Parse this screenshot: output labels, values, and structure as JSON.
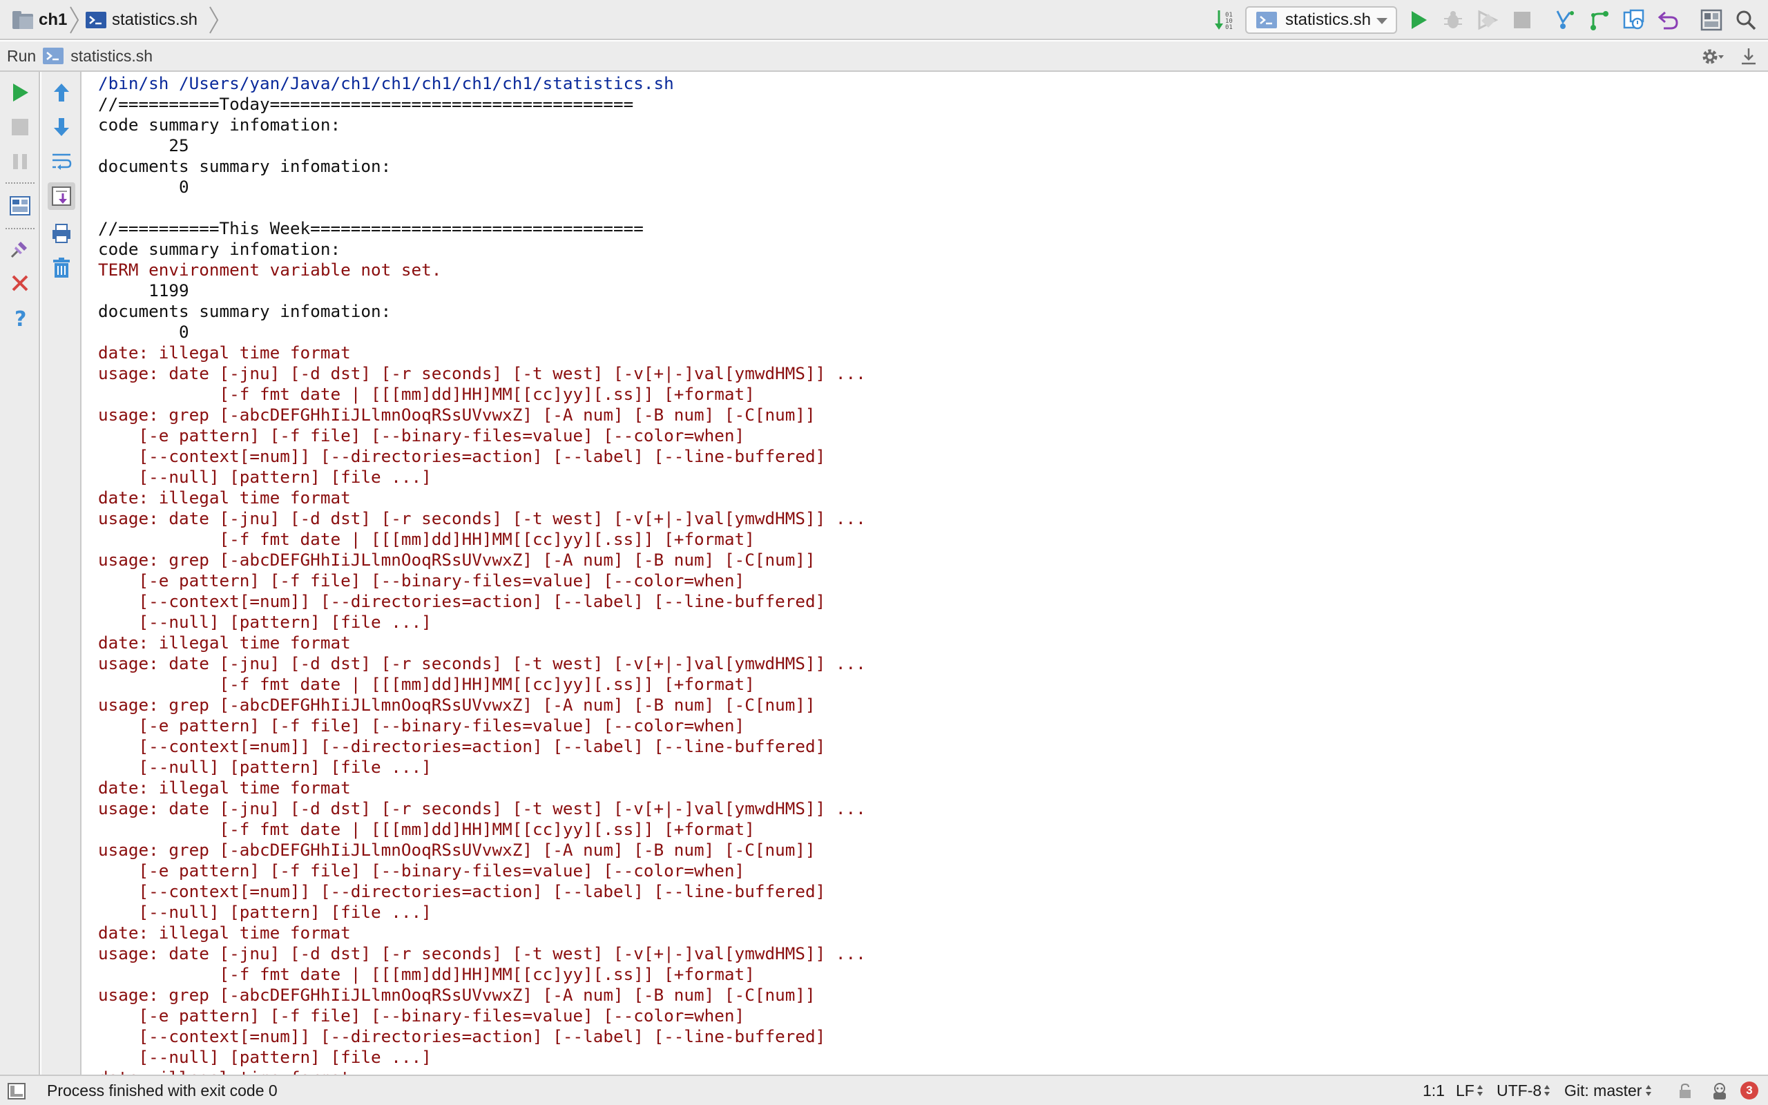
{
  "navbar": {
    "breadcrumbs": [
      {
        "label": "ch1",
        "icon": "folder-icon"
      },
      {
        "label": "statistics.sh",
        "icon": "shell-script-icon"
      }
    ],
    "run_config": {
      "label": "statistics.sh",
      "icon": "shell-script-icon"
    },
    "toolbar_icons": [
      "sort-icon",
      "run-icon",
      "debug-icon",
      "coverage-icon",
      "stop-icon",
      "vcs-update-icon",
      "vcs-commit-icon",
      "vcs-compare-icon",
      "vcs-revert-icon",
      "project-structure-icon",
      "search-icon"
    ]
  },
  "run_window": {
    "title": "Run",
    "tab_label": "statistics.sh",
    "header_icons": [
      "gear-icon",
      "hide-icon"
    ]
  },
  "left_toolbar": {
    "primary": [
      "rerun-icon",
      "stop-icon",
      "pause-icon",
      "restore-layout-icon",
      "pin-icon",
      "close-icon",
      "help-icon"
    ],
    "secondary": [
      "scroll-up-icon",
      "scroll-down-icon",
      "soft-wrap-icon",
      "scroll-to-end-icon",
      "print-icon",
      "clear-all-icon"
    ]
  },
  "console": {
    "lines": [
      {
        "text": "/bin/sh /Users/yan/Java/ch1/ch1/ch1/ch1/ch1/statistics.sh",
        "type": "sys"
      },
      {
        "text": "//==========Today====================================",
        "type": "out"
      },
      {
        "text": "code summary infomation:",
        "type": "out"
      },
      {
        "text": "       25",
        "type": "out"
      },
      {
        "text": "documents summary infomation:",
        "type": "out"
      },
      {
        "text": "        0",
        "type": "out"
      },
      {
        "text": "",
        "type": "out"
      },
      {
        "text": "//==========This Week=================================",
        "type": "out"
      },
      {
        "text": "code summary infomation:",
        "type": "out"
      },
      {
        "text": "TERM environment variable not set.",
        "type": "err"
      },
      {
        "text": "     1199",
        "type": "out"
      },
      {
        "text": "documents summary infomation:",
        "type": "out"
      },
      {
        "text": "        0",
        "type": "out"
      },
      {
        "text": "date: illegal time format",
        "type": "err"
      },
      {
        "text": "usage: date [-jnu] [-d dst] [-r seconds] [-t west] [-v[+|-]val[ymwdHMS]] ...",
        "type": "err"
      },
      {
        "text": "            [-f fmt date | [[[mm]dd]HH]MM[[cc]yy][.ss]] [+format]",
        "type": "err"
      },
      {
        "text": "usage: grep [-abcDEFGHhIiJLlmnOoqRSsUVvwxZ] [-A num] [-B num] [-C[num]]",
        "type": "err"
      },
      {
        "text": "    [-e pattern] [-f file] [--binary-files=value] [--color=when]",
        "type": "err"
      },
      {
        "text": "    [--context[=num]] [--directories=action] [--label] [--line-buffered]",
        "type": "err"
      },
      {
        "text": "    [--null] [pattern] [file ...]",
        "type": "err"
      },
      {
        "text": "date: illegal time format",
        "type": "err"
      },
      {
        "text": "usage: date [-jnu] [-d dst] [-r seconds] [-t west] [-v[+|-]val[ymwdHMS]] ...",
        "type": "err"
      },
      {
        "text": "            [-f fmt date | [[[mm]dd]HH]MM[[cc]yy][.ss]] [+format]",
        "type": "err"
      },
      {
        "text": "usage: grep [-abcDEFGHhIiJLlmnOoqRSsUVvwxZ] [-A num] [-B num] [-C[num]]",
        "type": "err"
      },
      {
        "text": "    [-e pattern] [-f file] [--binary-files=value] [--color=when]",
        "type": "err"
      },
      {
        "text": "    [--context[=num]] [--directories=action] [--label] [--line-buffered]",
        "type": "err"
      },
      {
        "text": "    [--null] [pattern] [file ...]",
        "type": "err"
      },
      {
        "text": "date: illegal time format",
        "type": "err"
      },
      {
        "text": "usage: date [-jnu] [-d dst] [-r seconds] [-t west] [-v[+|-]val[ymwdHMS]] ...",
        "type": "err"
      },
      {
        "text": "            [-f fmt date | [[[mm]dd]HH]MM[[cc]yy][.ss]] [+format]",
        "type": "err"
      },
      {
        "text": "usage: grep [-abcDEFGHhIiJLlmnOoqRSsUVvwxZ] [-A num] [-B num] [-C[num]]",
        "type": "err"
      },
      {
        "text": "    [-e pattern] [-f file] [--binary-files=value] [--color=when]",
        "type": "err"
      },
      {
        "text": "    [--context[=num]] [--directories=action] [--label] [--line-buffered]",
        "type": "err"
      },
      {
        "text": "    [--null] [pattern] [file ...]",
        "type": "err"
      },
      {
        "text": "date: illegal time format",
        "type": "err"
      },
      {
        "text": "usage: date [-jnu] [-d dst] [-r seconds] [-t west] [-v[+|-]val[ymwdHMS]] ...",
        "type": "err"
      },
      {
        "text": "            [-f fmt date | [[[mm]dd]HH]MM[[cc]yy][.ss]] [+format]",
        "type": "err"
      },
      {
        "text": "usage: grep [-abcDEFGHhIiJLlmnOoqRSsUVvwxZ] [-A num] [-B num] [-C[num]]",
        "type": "err"
      },
      {
        "text": "    [-e pattern] [-f file] [--binary-files=value] [--color=when]",
        "type": "err"
      },
      {
        "text": "    [--context[=num]] [--directories=action] [--label] [--line-buffered]",
        "type": "err"
      },
      {
        "text": "    [--null] [pattern] [file ...]",
        "type": "err"
      },
      {
        "text": "date: illegal time format",
        "type": "err"
      },
      {
        "text": "usage: date [-jnu] [-d dst] [-r seconds] [-t west] [-v[+|-]val[ymwdHMS]] ...",
        "type": "err"
      },
      {
        "text": "            [-f fmt date | [[[mm]dd]HH]MM[[cc]yy][.ss]] [+format]",
        "type": "err"
      },
      {
        "text": "usage: grep [-abcDEFGHhIiJLlmnOoqRSsUVvwxZ] [-A num] [-B num] [-C[num]]",
        "type": "err"
      },
      {
        "text": "    [-e pattern] [-f file] [--binary-files=value] [--color=when]",
        "type": "err"
      },
      {
        "text": "    [--context[=num]] [--directories=action] [--label] [--line-buffered]",
        "type": "err"
      },
      {
        "text": "    [--null] [pattern] [file ...]",
        "type": "err"
      },
      {
        "text": "date: illegal time format",
        "type": "err"
      }
    ]
  },
  "statusbar": {
    "message": "Process finished with exit code 0",
    "position": "1:1",
    "line_separator": "LF",
    "encoding": "UTF-8",
    "git_branch": "Git: master",
    "notifications": "3"
  },
  "colors": {
    "run_green": "#2ba84a",
    "stop_gray": "#b0b0b0",
    "console_sys": "#0a2a9b",
    "console_err": "#8a0e0e",
    "badge_red": "#d64541"
  }
}
